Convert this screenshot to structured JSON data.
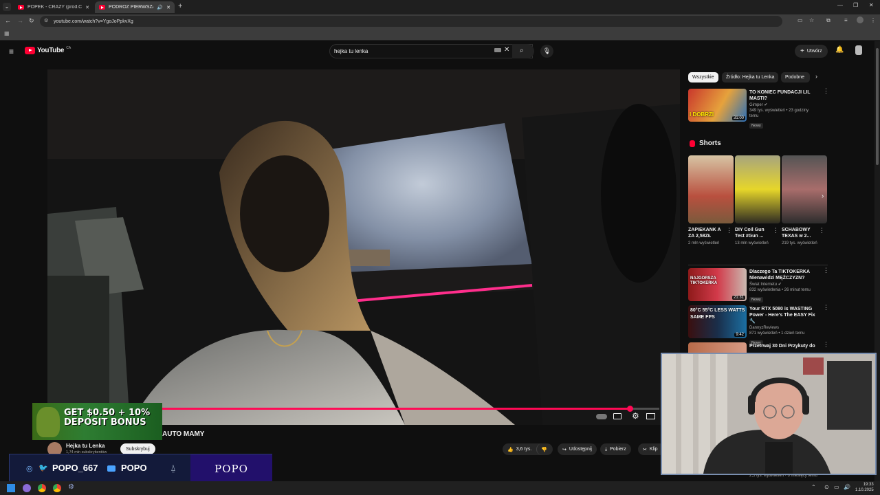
{
  "browser": {
    "tabs": [
      {
        "title": "POPEK - CRAZY (prod.CrackHou"
      },
      {
        "title": "PODRÓŻ PIERWSZĄ KLAS"
      }
    ],
    "url": "youtube.com/watch?v=YgoJoPpkvXg"
  },
  "youtube": {
    "logo": "YouTube",
    "region": "CA",
    "search_value": "hejka tu lenka",
    "create_label": "Utwórz"
  },
  "video": {
    "title_visible": "AUTO MAMY",
    "progress_fraction": 0.94,
    "channel_name": "Hejka tu Lenka",
    "subscribers": "1,74 mln subskrybentów",
    "subscribe_label": "Subskrybuj",
    "likes": "3,6 tys.",
    "share_label": "Udostępnij",
    "download_label": "Pobierz",
    "clip_label": "Klip"
  },
  "sidebar": {
    "chips": [
      "Wszystkie",
      "Źródło: Hejka tu Lenka",
      "Podobne"
    ],
    "top_video": {
      "title": "TO KONIEC FUNDACJI LIL MASTI?",
      "channel": "Gimper",
      "meta": "349 tys. wyświetleń • 23 godziny temu",
      "badge": "Nowy",
      "duration": "31:00",
      "thumb_text": "I DOBRZI"
    },
    "shorts_heading": "Shorts",
    "shorts": [
      {
        "title": "ZAPIEKANK A ZA 2,58ZŁ",
        "views": "2 mln wyświetleń"
      },
      {
        "title": "DIY Coil Gun Test #Gun ...",
        "views": "13 mln wyświetleń"
      },
      {
        "title": "SCHABOWY TEXAS w 2...",
        "views": "219 tys. wyświetleń"
      }
    ],
    "recs": [
      {
        "title": "Dlaczego Ta TIKTOKERKA Nienawidzi MĘŻCZYZN?",
        "channel": "Świat Internetu",
        "meta": "832 wyświetlenia • 26 minut temu",
        "badge": "Nowy",
        "duration": "21:31",
        "thumb_text": "NAJGORSZA TIKTOKERKA"
      },
      {
        "title": "Your RTX 5080 is WASTING Power - Here's The EASY Fix 🔧",
        "channel": "DannyzReviews",
        "meta": "871 wyświetleń • 1 dzień temu",
        "badge": "Nowy",
        "duration": "9:42",
        "thumb_text": "80°C 55°C LESS WATTS SAME FPS"
      },
      {
        "title": "Przetrwaj 30 Dni Przykuty do",
        "channel": "",
        "meta": "",
        "badge": "",
        "duration": "",
        "thumb_text": ""
      }
    ],
    "hidden_meta": "2,5 tys. wyświetleń • 6 miesięcy temu"
  },
  "overlay": {
    "ad_text": "GET $0.50 + 10% DEPOSIT BONUS",
    "social_handle": "POPO_667",
    "yt_handle": "POPO",
    "brand": "POPO"
  },
  "taskbar": {
    "time": "19:33",
    "date": "1.10.2025"
  },
  "colors": {
    "yt_red": "#ff0033",
    "progress": "#ff0a55",
    "overlay_bg": "#131a3a",
    "overlay_brand_bg": "#22106b"
  }
}
